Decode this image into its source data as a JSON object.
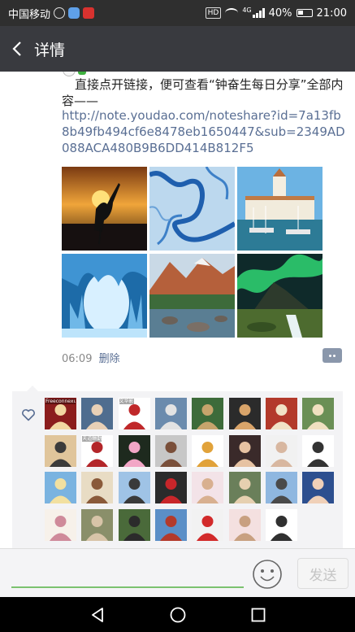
{
  "status_bar": {
    "carrier": "中国移动",
    "hd": "HD",
    "network": "4G",
    "battery": "40%",
    "time": "21:00"
  },
  "header": {
    "back_icon": "chevron-left-icon",
    "title": "详情"
  },
  "post": {
    "text": "直接点开链接，便可查看“钟奋生每日分享”全部内容——",
    "link": "http://note.youdao.com/noteshare?id=7a13fb8b49fb494cf6e8478eb1650447&sub=2349AD088ACA480B9B6DD414B812F5",
    "images": [
      {
        "name": "crane-sunset-photo"
      },
      {
        "name": "winding-river-photo"
      },
      {
        "name": "harbor-station-photo"
      },
      {
        "name": "ice-cave-photo"
      },
      {
        "name": "mountain-lake-photo"
      },
      {
        "name": "aurora-mountain-photo"
      }
    ],
    "time": "06:09",
    "delete_label": "删除",
    "comment_icon": "comment-more-icon"
  },
  "likes": {
    "icon": "heart-outline-icon",
    "avatars": [
      {
        "label": "Freeconnexus Ltd"
      },
      {
        "label": ""
      },
      {
        "label": "文华影"
      },
      {
        "label": ""
      },
      {
        "label": ""
      },
      {
        "label": ""
      },
      {
        "label": ""
      },
      {
        "label": ""
      },
      {
        "label": ""
      },
      {
        "label": "天道酬勤"
      },
      {
        "label": ""
      },
      {
        "label": ""
      },
      {
        "label": ""
      },
      {
        "label": ""
      },
      {
        "label": ""
      },
      {
        "label": ""
      },
      {
        "label": ""
      },
      {
        "label": ""
      },
      {
        "label": ""
      },
      {
        "label": ""
      },
      {
        "label": ""
      },
      {
        "label": ""
      },
      {
        "label": ""
      },
      {
        "label": ""
      },
      {
        "label": ""
      },
      {
        "label": ""
      },
      {
        "label": ""
      },
      {
        "label": ""
      },
      {
        "label": ""
      },
      {
        "label": ""
      },
      {
        "label": ""
      },
      {
        "label": ""
      }
    ]
  },
  "input_bar": {
    "placeholder": "",
    "emoji_icon": "emoji-smile-icon",
    "send_label": "发送"
  },
  "nav": {
    "back": "nav-back-icon",
    "home": "nav-home-icon",
    "recents": "nav-recents-icon"
  }
}
